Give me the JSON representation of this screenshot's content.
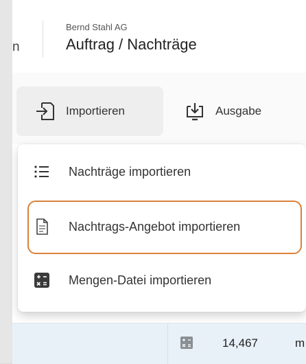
{
  "header": {
    "prev_fragment": "n",
    "company": "Bernd Stahl AG",
    "title": "Auftrag / Nachträge"
  },
  "toolbar": {
    "import_label": "Importieren",
    "import_icon": "import-icon",
    "output_label": "Ausgabe",
    "output_icon": "download-icon"
  },
  "menu": {
    "items": [
      {
        "label": "Nachträge importieren",
        "icon": "list-icon"
      },
      {
        "label": "Nachtrags-Angebot importieren",
        "icon": "document-icon",
        "highlighted": true
      },
      {
        "label": "Mengen-Datei importieren",
        "icon": "calculator-icon"
      }
    ],
    "highlight_color": "#d9813a"
  },
  "table_row": {
    "quantity": "14,467",
    "unit_fragment": "m",
    "icon": "calculator-icon"
  }
}
